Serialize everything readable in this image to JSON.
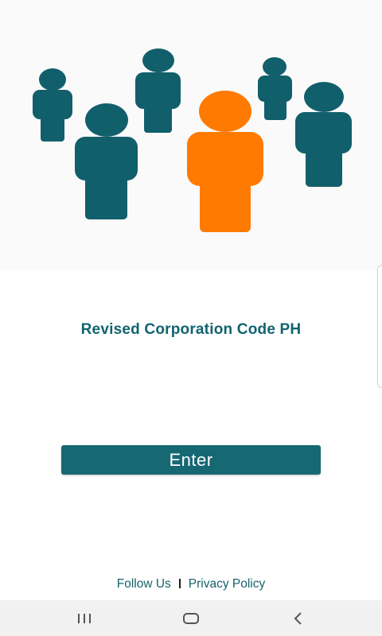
{
  "app": {
    "title": "Revised Corporation Code PH"
  },
  "hero": {
    "icon": "people-group-illustration",
    "colors": {
      "teal": "#115f6b",
      "orange": "#ff7a00"
    }
  },
  "enter": {
    "label": "Enter"
  },
  "footer": {
    "follow_us": "Follow Us",
    "separator": "I",
    "privacy_policy": "Privacy Policy"
  },
  "navbar": {
    "recent_icon": "recent-apps-icon",
    "home_icon": "home-icon",
    "back_icon": "back-icon"
  }
}
